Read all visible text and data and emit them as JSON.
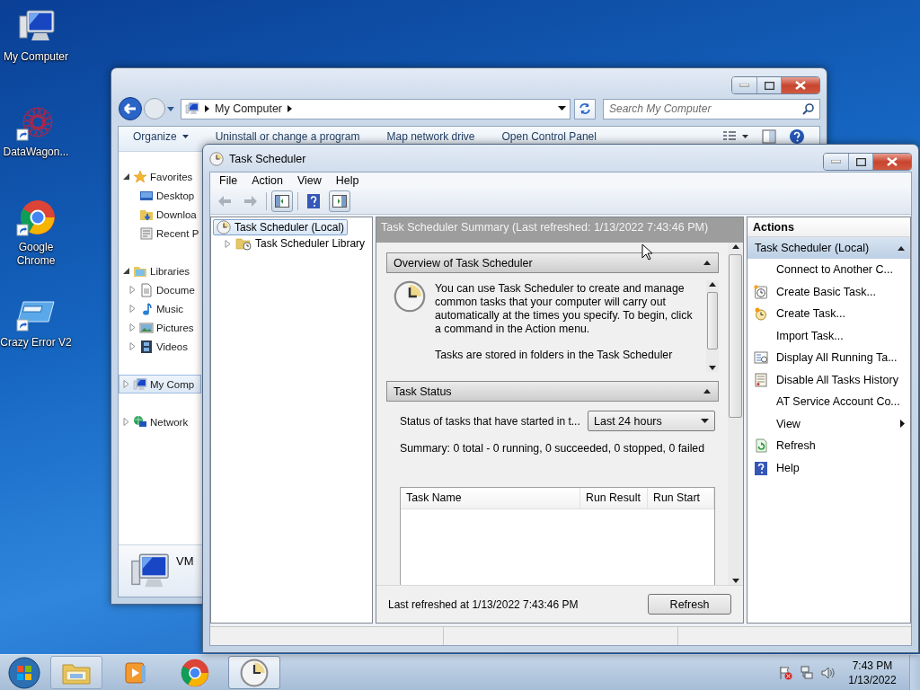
{
  "desktop_icons": [
    {
      "label": "My Computer",
      "kind": "computer",
      "shortcut": false
    },
    {
      "label": "DataWagon...",
      "kind": "web",
      "shortcut": true
    },
    {
      "label": "Google Chrome",
      "kind": "chrome",
      "shortcut": true
    },
    {
      "label": "Crazy Error V2",
      "kind": "app",
      "shortcut": true
    }
  ],
  "explorer": {
    "address": "My Computer",
    "search": {
      "placeholder": "Search My Computer"
    },
    "commands": [
      {
        "label": "Organize",
        "kind": "menu"
      },
      {
        "label": "Uninstall or change a program",
        "kind": "plain"
      },
      {
        "label": "Map network drive",
        "kind": "plain"
      },
      {
        "label": "Open Control Panel",
        "kind": "plain"
      }
    ],
    "nav": [
      {
        "label": "Favorites",
        "kind": "star",
        "expanded": true,
        "selected": false,
        "children": [
          {
            "label": "Desktop",
            "kind": "desktop",
            "selected": false
          },
          {
            "label": "Downloa",
            "kind": "download",
            "selected": false
          },
          {
            "label": "Recent P",
            "kind": "recent",
            "selected": false
          }
        ]
      },
      {
        "label": "Libraries",
        "kind": "library",
        "expanded": true,
        "selected": false,
        "children": [
          {
            "label": "Docume",
            "kind": "document",
            "expanded": false,
            "selected": false
          },
          {
            "label": "Music",
            "kind": "music",
            "expanded": false,
            "selected": false
          },
          {
            "label": "Pictures",
            "kind": "picture",
            "expanded": false,
            "selected": false
          },
          {
            "label": "Videos",
            "kind": "video",
            "expanded": false,
            "selected": false
          }
        ]
      },
      {
        "label": "My Comp",
        "kind": "computer",
        "expanded": false,
        "selected": true
      },
      {
        "label": "Network",
        "kind": "network",
        "expanded": false,
        "selected": false
      }
    ],
    "details": {
      "name": "VM"
    }
  },
  "task_scheduler": {
    "title": "Task Scheduler",
    "menu": [
      "File",
      "Action",
      "View",
      "Help"
    ],
    "tree": [
      {
        "label": "Task Scheduler (Local)",
        "selected": true,
        "children": [
          {
            "label": "Task Scheduler Library",
            "expanded": false,
            "selected": false
          }
        ]
      }
    ],
    "summary_header": "Task Scheduler Summary (Last refreshed: 1/13/2022 7:43:46 PM)",
    "overview": {
      "title": "Overview of Task Scheduler",
      "expanded": true,
      "paragraphs": [
        "You can use Task Scheduler to create and manage common tasks that your computer will carry out automatically at the times you specify. To begin, click a command in the Action menu.",
        "Tasks are stored in folders in the Task Scheduler"
      ]
    },
    "status": {
      "title": "Task Status",
      "expanded": true,
      "filter_label": "Status of tasks that have started in t...",
      "filter_value": "Last 24 hours",
      "summary": "Summary: 0 total - 0 running, 0 succeeded, 0 stopped, 0 failed",
      "columns": [
        "Task Name",
        "Run Result",
        "Run Start"
      ]
    },
    "footer": {
      "text": "Last refreshed at 1/13/2022 7:43:46 PM",
      "button": "Refresh"
    },
    "actions": {
      "title": "Actions",
      "group": {
        "label": "Task Scheduler (Local)",
        "expanded": true,
        "items": [
          {
            "label": "Connect to Another C...",
            "kind": "plain"
          },
          {
            "label": "Create Basic Task...",
            "kind": "basic-task"
          },
          {
            "label": "Create Task...",
            "kind": "create-task"
          },
          {
            "label": "Import Task...",
            "kind": "plain"
          },
          {
            "label": "Display All Running Ta...",
            "kind": "running"
          },
          {
            "label": "Disable All Tasks History",
            "kind": "history"
          },
          {
            "label": "AT Service Account Co...",
            "kind": "plain"
          },
          {
            "label": "View",
            "kind": "submenu"
          },
          {
            "label": "Refresh",
            "kind": "refresh"
          },
          {
            "label": "Help",
            "kind": "help"
          }
        ]
      }
    }
  },
  "taskbar": {
    "items": [
      {
        "kind": "explorer",
        "open": true,
        "selected": false
      },
      {
        "kind": "media",
        "open": false,
        "selected": false
      },
      {
        "kind": "chrome",
        "open": false,
        "selected": false
      },
      {
        "kind": "clock",
        "open": true,
        "selected": true
      }
    ],
    "time": "7:43 PM",
    "date": "1/13/2022"
  }
}
